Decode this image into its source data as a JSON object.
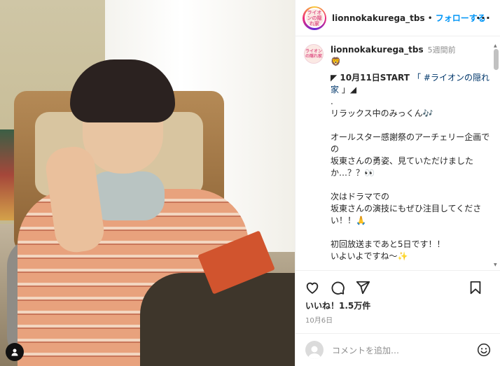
{
  "post": {
    "username": "lionnokakurega_tbs",
    "follow_label": "フォローする",
    "separator": "•",
    "more_label": "···",
    "avatar_text": "ライオンの隠れ家",
    "time_ago": "5週間前",
    "lion_emoji": "🦁",
    "caption_lines": {
      "l1_mark": "◤",
      "l1_date": " 10月11日START ",
      "l1_quote_open": "「 ",
      "l1_tag": "#ライオンの隠れ家",
      "l1_quote_close": " 」",
      "l1_mark2": "◢",
      "l2": ".",
      "l3": "リラックス中のみっくん🎶",
      "l4": "",
      "l5": "オールスター感謝祭のアーチェリー企画での",
      "l6": "坂東さんの勇姿、見ていただけましたか…？？👀",
      "l7": "",
      "l8": "次はドラマでの",
      "l9": "坂東さんの演技にもぜひ注目してください！！🙏",
      "l10": "",
      "l11": "初回放送まであと5日です！！",
      "l12": "いよいよですね〜✨"
    },
    "likes": "いいね！1.5万件",
    "date": "10月6日",
    "comment_placeholder": "コメントを追加…"
  },
  "icons": {
    "like": "heart-icon",
    "comment": "comment-icon",
    "share": "share-icon",
    "save": "bookmark-icon",
    "emoji": "emoji-icon",
    "user_tag": "person-icon"
  },
  "colors": {
    "accent": "#0095f6",
    "text": "#262626",
    "muted": "#8e8e8e"
  }
}
